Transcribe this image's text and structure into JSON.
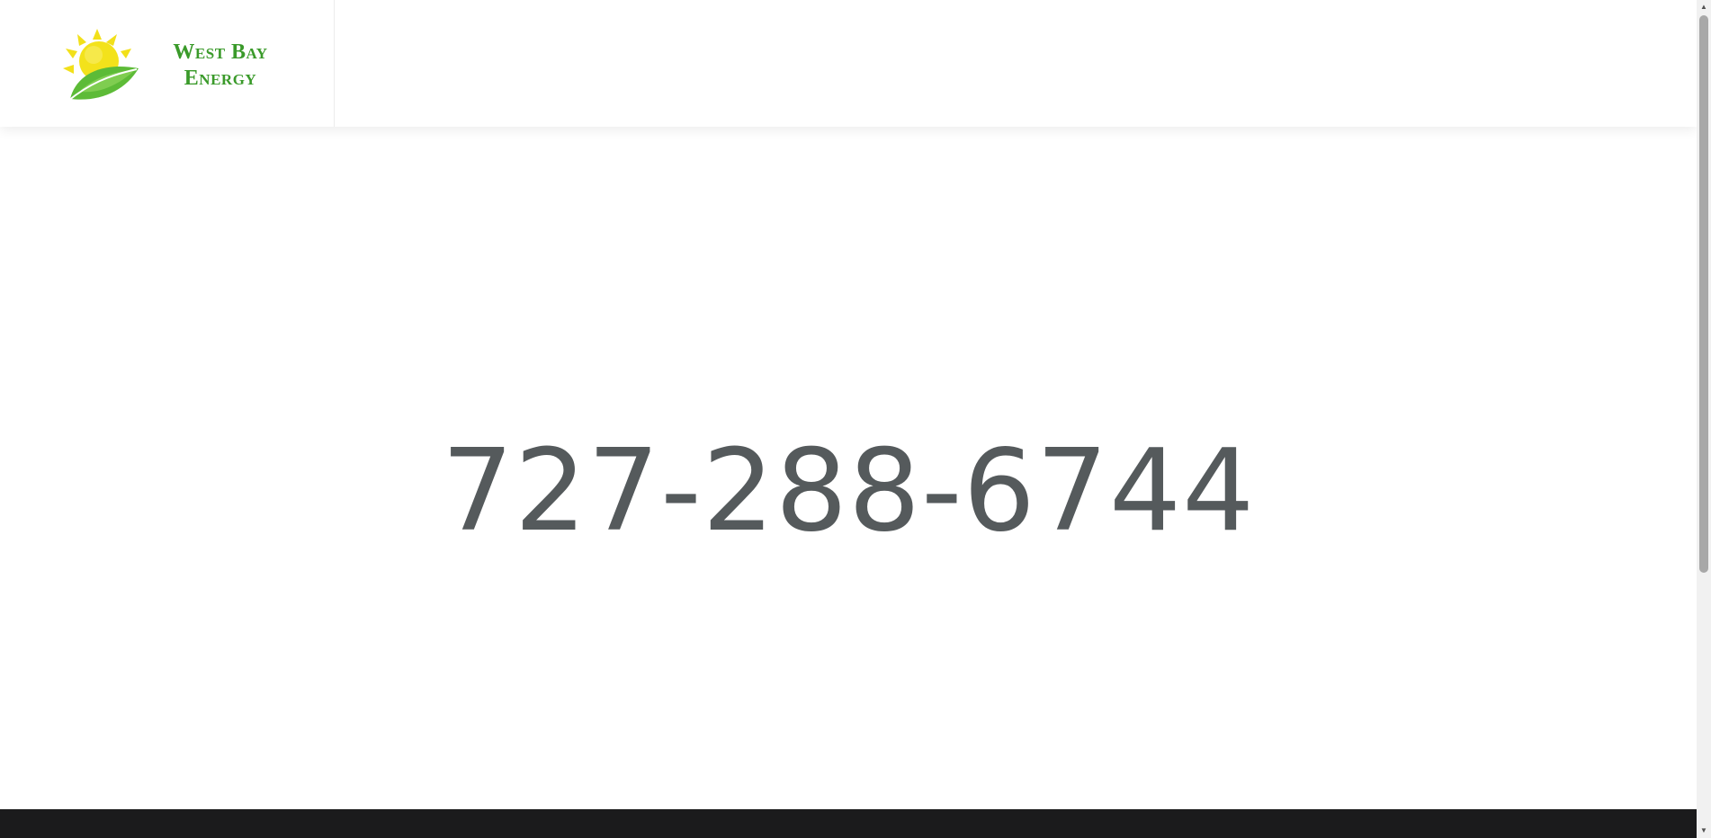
{
  "header": {
    "logo": {
      "line1": "West Bay",
      "line2": "Energy"
    }
  },
  "main": {
    "phone": "727-288-6744"
  },
  "colors": {
    "brand_green": "#3a9a2a",
    "sun_yellow": "#f2e01a",
    "text_gray": "#555a5c",
    "footer": "#1b1b1c"
  },
  "scrollbar": {
    "up_icon": "triangle-up-icon",
    "down_icon": "triangle-down-icon"
  }
}
